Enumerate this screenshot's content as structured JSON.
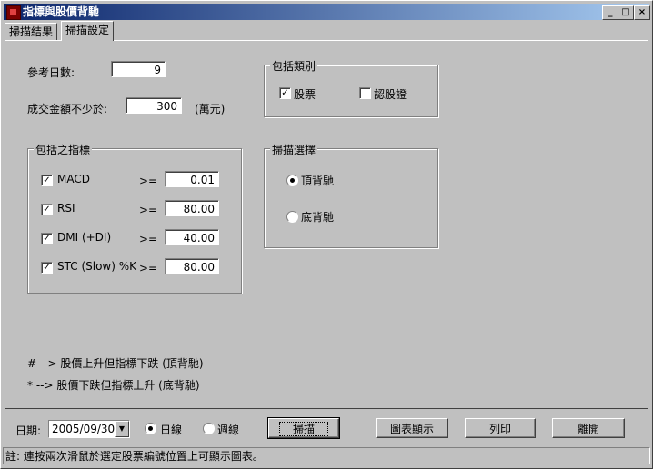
{
  "window": {
    "title": "指標與股價背馳"
  },
  "tabs": [
    {
      "label": "掃描結果",
      "active": false
    },
    {
      "label": "掃描設定",
      "active": true
    }
  ],
  "settings": {
    "days_label": "參考日數:",
    "days_value": "9",
    "amount_label": "成交金額不少於:",
    "amount_value": "300",
    "amount_unit": "(萬元)"
  },
  "indicators": {
    "title": "包括之指標",
    "items": [
      {
        "name": "MACD",
        "checked": true,
        "op": ">=",
        "value": "0.01"
      },
      {
        "name": "RSI",
        "checked": true,
        "op": ">=",
        "value": "80.00"
      },
      {
        "name": "DMI (+DI)",
        "checked": true,
        "op": ">=",
        "value": "40.00"
      },
      {
        "name": "STC (Slow) %K",
        "checked": true,
        "op": ">=",
        "value": "80.00"
      }
    ]
  },
  "categories": {
    "title": "包括類別",
    "items": [
      {
        "label": "股票",
        "checked": true
      },
      {
        "label": "認股證",
        "checked": false
      }
    ]
  },
  "scan_choice": {
    "title": "掃描選擇",
    "options": [
      {
        "label": "頂背馳",
        "selected": true
      },
      {
        "label": "底背馳",
        "selected": false
      }
    ]
  },
  "notes": {
    "top": "# --> 股價上升但指標下跌 (頂背馳)",
    "bottom": "* --> 股價下跌但指標上升 (底背馳)"
  },
  "bottom": {
    "date_label": "日期:",
    "date_value": "2005/09/30",
    "period_options": [
      {
        "label": "日線",
        "selected": true
      },
      {
        "label": "週線",
        "selected": false
      }
    ],
    "scan_button": "掃描",
    "chart_button": "圖表顯示",
    "print_button": "列印",
    "exit_button": "離開"
  },
  "status": "註: 連按兩次滑鼠於選定股票編號位置上可顯示圖表。",
  "icons": {
    "app": "app-icon",
    "minimize": "minimize-icon",
    "maximize": "maximize-icon",
    "close": "close-icon",
    "checkmark": "checkmark-icon",
    "dropdown": "chevron-down-icon"
  }
}
